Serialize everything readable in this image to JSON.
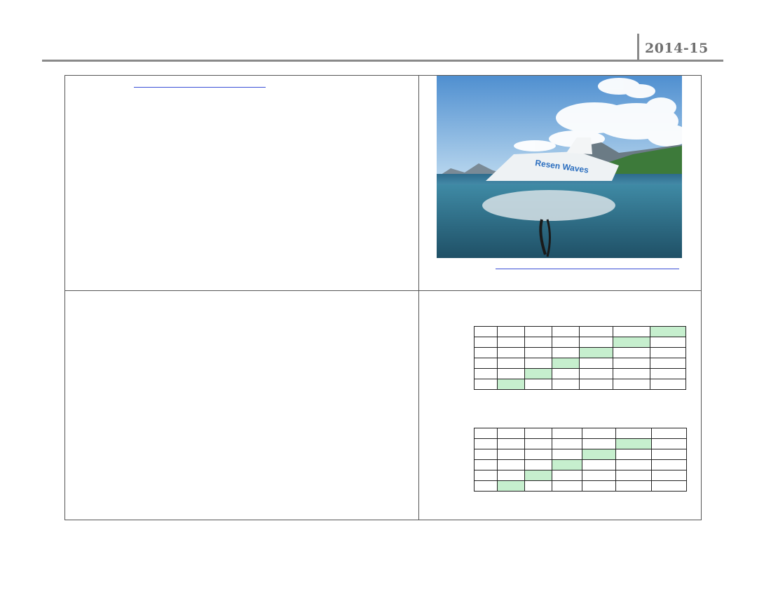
{
  "header": {
    "year": "2014-15"
  },
  "photo": {
    "brand_text": "Resen Waves",
    "colors": {
      "sky": "#6fa8dc",
      "water": "#2f6f86",
      "buoy": "#e9eef2"
    }
  },
  "grid_1": {
    "rows": 6,
    "cols": 7,
    "highlight_color": "#c6efce",
    "highlighted": [
      [
        0,
        6
      ],
      [
        1,
        5
      ],
      [
        2,
        4
      ],
      [
        3,
        3
      ],
      [
        4,
        2
      ],
      [
        5,
        1
      ]
    ]
  },
  "grid_2": {
    "rows": 6,
    "cols": 7,
    "highlight_color": "#c6efce",
    "highlighted": [
      [
        1,
        5
      ],
      [
        2,
        4
      ],
      [
        3,
        3
      ],
      [
        4,
        2
      ],
      [
        5,
        1
      ]
    ]
  }
}
